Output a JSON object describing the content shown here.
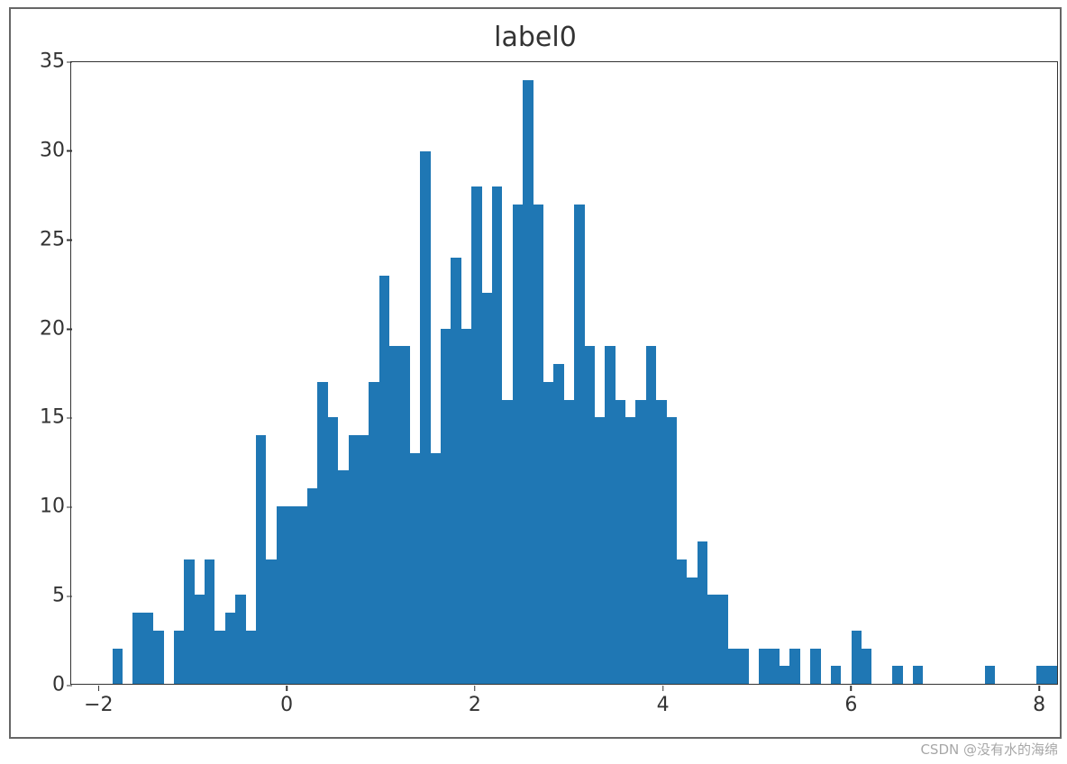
{
  "chart_data": {
    "type": "bar",
    "title": "label0",
    "xlabel": "",
    "ylabel": "",
    "xlim": [
      -2.3,
      8.2
    ],
    "ylim": [
      0,
      35
    ],
    "x_ticks": [
      -2,
      0,
      2,
      4,
      6,
      8
    ],
    "y_ticks": [
      0,
      5,
      10,
      15,
      20,
      25,
      30,
      35
    ],
    "bar_color": "#1f77b4",
    "bin_edges_start": -2.3,
    "bin_width_approx": 0.131,
    "values": [
      0,
      0,
      0,
      0,
      2,
      0,
      4,
      4,
      3,
      0,
      3,
      7,
      5,
      7,
      3,
      4,
      5,
      3,
      14,
      7,
      10,
      10,
      10,
      11,
      17,
      15,
      12,
      14,
      14,
      17,
      23,
      19,
      19,
      13,
      30,
      13,
      20,
      24,
      20,
      28,
      22,
      28,
      16,
      27,
      34,
      27,
      17,
      18,
      16,
      27,
      19,
      15,
      19,
      16,
      15,
      16,
      19,
      16,
      15,
      7,
      6,
      8,
      5,
      5,
      2,
      2,
      0,
      2,
      2,
      1,
      2,
      0,
      2,
      0,
      1,
      0,
      3,
      2,
      0,
      0,
      1,
      0,
      1,
      0,
      0,
      0,
      0,
      0,
      0,
      1,
      0,
      0,
      0,
      0,
      1,
      1
    ]
  },
  "watermark": "CSDN @没有水的海绵"
}
